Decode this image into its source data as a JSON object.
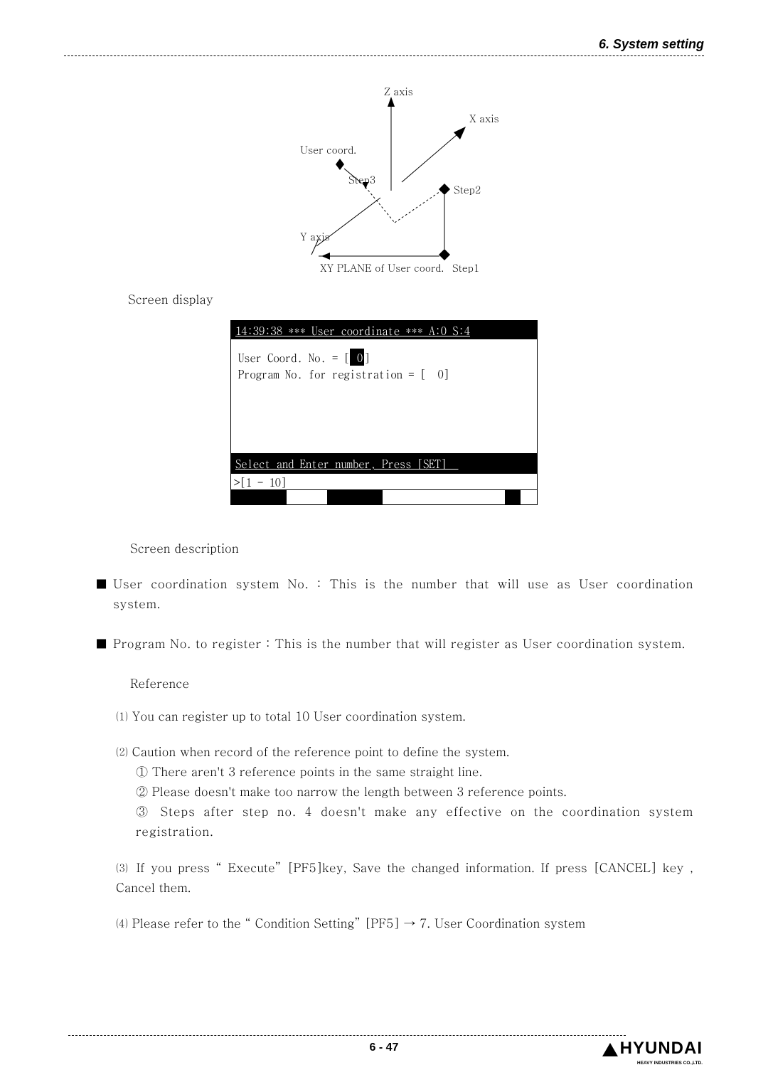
{
  "header": {
    "chapter": "6. System setting"
  },
  "diagram": {
    "z_axis": "Z axis",
    "x_axis": "X axis",
    "y_axis": "Y axis",
    "user_coord": "User coord.",
    "step1": "Step1",
    "step2": "Step2",
    "step3": "Step3",
    "plane": "XY PLANE of User coord."
  },
  "screen_display_label": "Screen display",
  "console": {
    "title": "14:39:38 *** User coordinate *** A:0 S:4",
    "body_prefix": "User Coord. No. = [",
    "body_hl": " 0",
    "body_suffix": "]",
    "body_line2": "Program No. for registration = [  0]",
    "status": "Select and Enter number, Press [SET]  ",
    "input_row": ">[1 - 10]"
  },
  "screen_description_label": "Screen description",
  "bullets": [
    "User coordination system No. : This is the number that will use as User coordination system.",
    "Program No. to register : This is the number that will register as User coordination system."
  ],
  "reference_label": "Reference",
  "ref_items": {
    "r1": "⑴ You can register up to total 10 User coordination system.",
    "r2": "⑵ Caution when record of the reference point to define the system.",
    "r2c1": "① There aren't 3 reference points in the same straight line.",
    "r2c2": "② Please doesn't make too narrow the length between 3 reference points.",
    "r2c3": "③ Steps after step no. 4 doesn't make any effective on the coordination system registration.",
    "r3": "⑶ If you press “ Execute” [PF5]key, Save the changed information. If press [CANCEL] key , Cancel them.",
    "r4": "⑷ Please refer to the “ Condition Setting” [PF5] →  7. User Coordination system"
  },
  "footer": {
    "page": "6 - 47",
    "logo_main": "HYUNDAI",
    "logo_sub": "HEAVY INDUSTRIES CO.,LTD."
  }
}
